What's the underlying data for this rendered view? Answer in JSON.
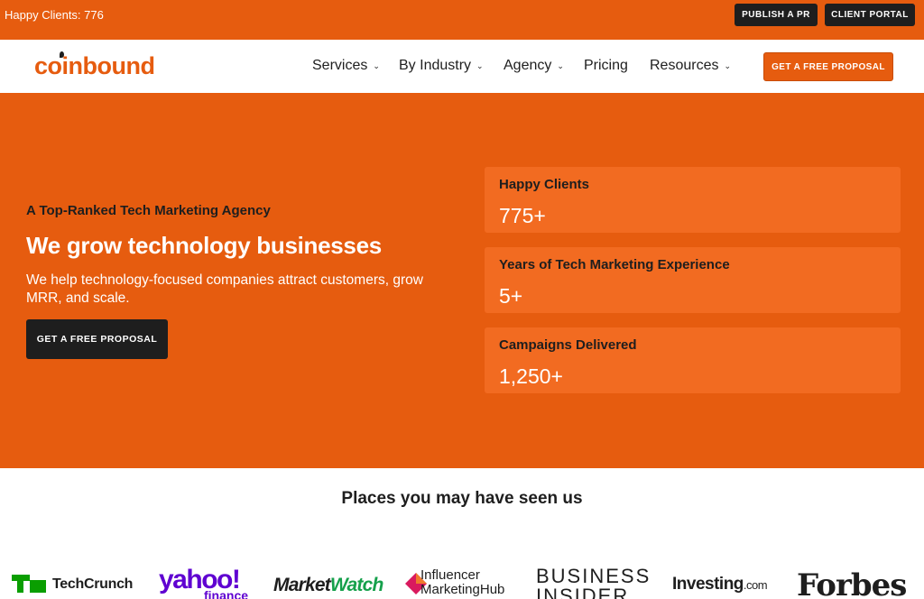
{
  "topbar": {
    "counter_text": "Happy Clients: 776",
    "publish_label": "PUBLISH A PR",
    "portal_label": "CLIENT PORTAL"
  },
  "nav": {
    "logo_text": "coinbound",
    "items": [
      {
        "label": "Services",
        "has_dropdown": true
      },
      {
        "label": "By Industry",
        "has_dropdown": true
      },
      {
        "label": "Agency",
        "has_dropdown": true
      },
      {
        "label": "Pricing",
        "has_dropdown": false
      },
      {
        "label": "Resources",
        "has_dropdown": true
      }
    ],
    "cta_label": "GET A FREE PROPOSAL"
  },
  "hero": {
    "eyebrow": "A Top-Ranked Tech Marketing Agency",
    "headline": "We grow technology businesses",
    "subtext": "We help technology-focused companies attract customers, grow MRR, and scale.",
    "cta_label": "GET A FREE PROPOSAL",
    "stats": [
      {
        "label": "Happy Clients",
        "value": "775+"
      },
      {
        "label": "Years of Tech Marketing Experience",
        "value": "5+"
      },
      {
        "label": "Campaigns Delivered",
        "value": "1,250+"
      }
    ]
  },
  "seen": {
    "title": "Places you may have seen us",
    "logos": {
      "techcrunch": "TechCrunch",
      "yahoo": "yahoo!",
      "yahoo_sub": "finance",
      "marketwatch_a": "Market",
      "marketwatch_b": "Watch",
      "imh_line1": "Influencer",
      "imh_line2": "MarketingHub",
      "bi_line1": "BUSINESS",
      "bi_line2": "INSIDER",
      "investing": "Investing",
      "investing_suffix": ".com",
      "forbes": "Forbes"
    }
  },
  "colors": {
    "brand_orange": "#e65c0f",
    "stat_orange": "#f26b21",
    "dark": "#1e1e1e"
  },
  "icons": {
    "dropdown": "chevron-down-icon",
    "logo_leaf": "leaf-icon"
  }
}
